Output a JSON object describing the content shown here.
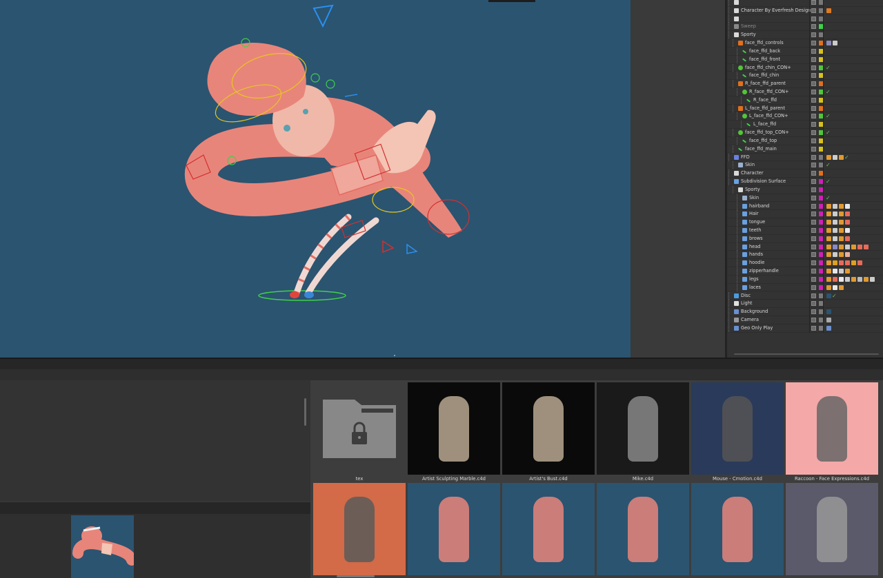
{
  "object_manager": {
    "rows": [
      {
        "label": "",
        "depth": 0,
        "icon": "null-object-icon",
        "color": "#777777",
        "tags": [],
        "check": false
      },
      {
        "label": "Character By Everfresh Design",
        "depth": 0,
        "icon": "null-object-icon",
        "color": "#7a7a7a",
        "tags": [
          "#e07a20"
        ],
        "check": false
      },
      {
        "label": "",
        "depth": 0,
        "icon": "null-object-icon",
        "color": "#777777",
        "tags": [],
        "check": false
      },
      {
        "label": "Sweep",
        "depth": 0,
        "icon": "sweep-icon",
        "color": "#3ed14a",
        "tags": [],
        "check": false,
        "dim": true
      },
      {
        "label": "Sporty",
        "depth": 0,
        "icon": "null-object-icon",
        "color": "#7a7a7a",
        "tags": [],
        "check": false
      },
      {
        "label": "face_ffd_controls",
        "depth": 1,
        "icon": "joint-icon",
        "color": "#e0701c",
        "tags": [
          "#8a8ab8",
          "#cccccc"
        ],
        "check": false
      },
      {
        "label": "face_ffd_back",
        "depth": 2,
        "icon": "bone-icon",
        "color": "#d7c21c",
        "tags": [],
        "check": false
      },
      {
        "label": "face_ffd_front",
        "depth": 2,
        "icon": "bone-icon",
        "color": "#d7c21c",
        "tags": [],
        "check": false
      },
      {
        "label": "face_ffd_chin_CON+",
        "depth": 1,
        "icon": "controller-icon",
        "color": "#52c63a",
        "tags": [],
        "check": true
      },
      {
        "label": "face_ffd_chin",
        "depth": 2,
        "icon": "bone-icon",
        "color": "#d7c21c",
        "tags": [],
        "check": false
      },
      {
        "label": "R_face_ffd_parent",
        "depth": 1,
        "icon": "joint-icon",
        "color": "#e0701c",
        "tags": [],
        "check": false
      },
      {
        "label": "R_face_ffd_CON+",
        "depth": 2,
        "icon": "controller-icon",
        "color": "#52c63a",
        "tags": [],
        "check": true
      },
      {
        "label": "R_face_ffd",
        "depth": 3,
        "icon": "bone-icon",
        "color": "#d7c21c",
        "tags": [],
        "check": false
      },
      {
        "label": "L_face_ffd_parent",
        "depth": 1,
        "icon": "joint-icon",
        "color": "#e0701c",
        "tags": [],
        "check": false
      },
      {
        "label": "L_face_ffd_CON+",
        "depth": 2,
        "icon": "controller-icon",
        "color": "#52c63a",
        "tags": [],
        "check": true
      },
      {
        "label": "L_face_ffd",
        "depth": 3,
        "icon": "bone-icon",
        "color": "#d7c21c",
        "tags": [],
        "check": false
      },
      {
        "label": "face_ffd_top_CON+",
        "depth": 1,
        "icon": "controller-icon",
        "color": "#52c63a",
        "tags": [],
        "check": true
      },
      {
        "label": "face_ffd_top",
        "depth": 2,
        "icon": "bone-icon",
        "color": "#d7c21c",
        "tags": [],
        "check": false
      },
      {
        "label": "face_ffd_main",
        "depth": 1,
        "icon": "bone-icon",
        "color": "#d7c21c",
        "tags": [],
        "check": false
      },
      {
        "label": "FFD",
        "depth": 0,
        "icon": "ffd-icon",
        "color": "#7a7a7a",
        "tags": [
          "#e09a30",
          "#cccccc",
          "#e09a30"
        ],
        "check": true
      },
      {
        "label": "Skin",
        "depth": 1,
        "icon": "skin-icon",
        "color": "#7a7a7a",
        "tags": [],
        "check": true
      },
      {
        "label": "Character",
        "depth": 0,
        "icon": "null-object-icon",
        "color": "#e0701c",
        "tags": [],
        "check": false
      },
      {
        "label": "Subdivision Surface",
        "depth": 0,
        "icon": "subdivision-icon",
        "color": "#d01fb8",
        "tags": [],
        "check": true
      },
      {
        "label": "Sporty",
        "depth": 1,
        "icon": "null-object-icon",
        "color": "#d01fb8",
        "tags": [],
        "check": false
      },
      {
        "label": "Skin",
        "depth": 2,
        "icon": "skin-icon",
        "color": "#d01fb8",
        "tags": [],
        "check": true
      },
      {
        "label": "hairband",
        "depth": 2,
        "icon": "polygon-icon",
        "color": "#d01fb8",
        "tags": [
          "#e09a30",
          "#cccccc",
          "#e09a30",
          "#e8e8e8"
        ],
        "check": false
      },
      {
        "label": "Hair",
        "depth": 2,
        "icon": "polygon-icon",
        "color": "#d01fb8",
        "tags": [
          "#e09a30",
          "#cccccc",
          "#e09a30",
          "#e86a5a"
        ],
        "check": false
      },
      {
        "label": "tongue",
        "depth": 2,
        "icon": "polygon-icon",
        "color": "#d01fb8",
        "tags": [
          "#e09a30",
          "#cccccc",
          "#e09a30",
          "#e86a5a"
        ],
        "check": false
      },
      {
        "label": "teeth",
        "depth": 2,
        "icon": "polygon-icon",
        "color": "#d01fb8",
        "tags": [
          "#e09a30",
          "#cccccc",
          "#e09a30",
          "#e8e8e8"
        ],
        "check": false
      },
      {
        "label": "brows",
        "depth": 2,
        "icon": "polygon-icon",
        "color": "#d01fb8",
        "tags": [
          "#e09a30",
          "#cccccc",
          "#e09a30",
          "#e86a5a"
        ],
        "check": false
      },
      {
        "label": "head",
        "depth": 2,
        "icon": "polygon-icon",
        "color": "#d01fb8",
        "tags": [
          "#e09a30",
          "#8888cc",
          "#e09a30",
          "#cccccc",
          "#e09a30",
          "#e86a5a",
          "#e86a5a"
        ],
        "check": false
      },
      {
        "label": "hands",
        "depth": 2,
        "icon": "polygon-icon",
        "color": "#d01fb8",
        "tags": [
          "#e09a30",
          "#cccccc",
          "#e09a30",
          "#e8b0a0"
        ],
        "check": false
      },
      {
        "label": "hoodie",
        "depth": 2,
        "icon": "polygon-icon",
        "color": "#d01fb8",
        "tags": [
          "#e09a30",
          "#e0a020",
          "#e86a5a",
          "#e86a5a",
          "#e0a020",
          "#e86a5a"
        ],
        "check": false
      },
      {
        "label": "zipperhandle",
        "depth": 2,
        "icon": "polygon-icon",
        "color": "#d01fb8",
        "tags": [
          "#e09a30",
          "#e8e8e8",
          "#cccccc",
          "#e09a30"
        ],
        "check": false
      },
      {
        "label": "legs",
        "depth": 2,
        "icon": "polygon-icon",
        "color": "#d01fb8",
        "tags": [
          "#e09a30",
          "#e86a5a",
          "#e8e8e8",
          "#cccccc",
          "#e09a30",
          "#bbbbbb",
          "#e09a30",
          "#cccccc"
        ],
        "check": false
      },
      {
        "label": "laces",
        "depth": 2,
        "icon": "polygon-icon",
        "color": "#d01fb8",
        "tags": [
          "#e09a30",
          "#e8e8e8",
          "#e09a30"
        ],
        "check": false
      },
      {
        "label": "Disc",
        "depth": 0,
        "icon": "disc-icon",
        "color": "#7a7a7a",
        "tags": [
          "#2b5470"
        ],
        "check": true
      },
      {
        "label": "Light",
        "depth": 0,
        "icon": "light-icon",
        "color": "#7a7a7a",
        "tags": [],
        "check": false
      },
      {
        "label": "Background",
        "depth": 0,
        "icon": "background-icon",
        "color": "#7a7a7a",
        "tags": [
          "#2b5470"
        ],
        "check": false
      },
      {
        "label": "Camera",
        "depth": 0,
        "icon": "camera-icon",
        "color": "#7a7a7a",
        "tags": [
          "#aaaaaa"
        ],
        "check": false
      },
      {
        "label": "Geo Only Play",
        "depth": 0,
        "icon": "python-icon",
        "color": "#7a7a7a",
        "tags": [
          "#6a8fd0"
        ],
        "check": false
      }
    ]
  },
  "browser": {
    "tiles": [
      {
        "name": "tex",
        "kind": "folder"
      },
      {
        "name": "Artist Sculpting Marble.c4d",
        "kind": "scene-dark"
      },
      {
        "name": "Artist's Bust.c4d",
        "kind": "scene-dark"
      },
      {
        "name": "Mike.c4d",
        "kind": "scene-gray"
      },
      {
        "name": "Mouse - Cmotion.c4d",
        "kind": "scene-blue"
      },
      {
        "name": "Raccoon - Face Expressions.c4d",
        "kind": "scene-pink"
      },
      {
        "name": "",
        "kind": "scene-orange"
      },
      {
        "name": "",
        "kind": "scene-teal"
      },
      {
        "name": "",
        "kind": "scene-teal"
      },
      {
        "name": "",
        "kind": "scene-teal"
      },
      {
        "name": "",
        "kind": "scene-teal"
      },
      {
        "name": "",
        "kind": "scene-purple"
      }
    ]
  },
  "colors": {
    "viewport_bg": "#2b5470",
    "character_skin": "#e8857a",
    "panel_bg": "#333333"
  }
}
